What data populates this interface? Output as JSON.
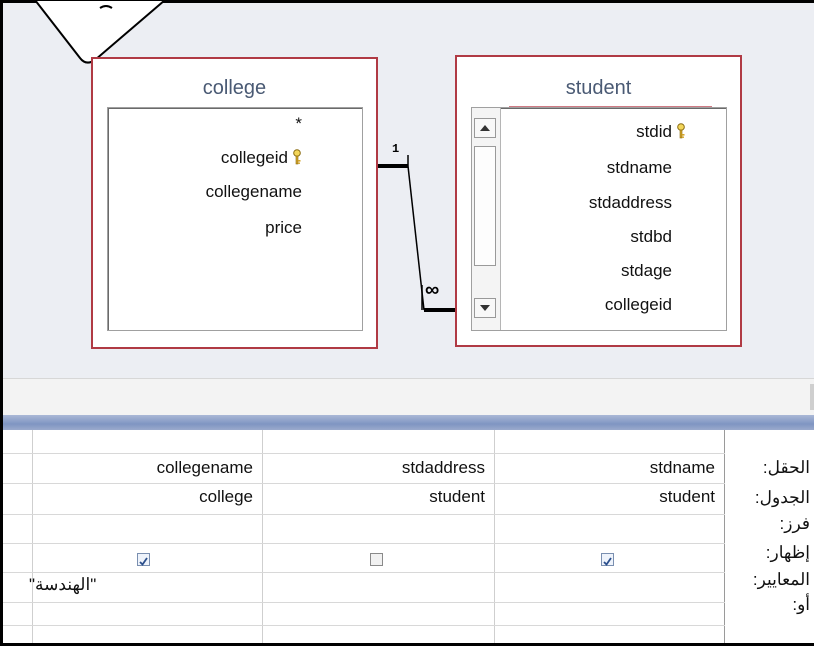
{
  "tables": {
    "college": {
      "title": "college",
      "fields": [
        "*",
        "collegeid",
        "collegename",
        "price"
      ]
    },
    "student": {
      "title": "student",
      "fields": [
        "stdid",
        "stdname",
        "stdaddress",
        "stdbd",
        "stdage",
        "collegeid"
      ]
    }
  },
  "relationship": {
    "one_label": "1",
    "many_label": "∞"
  },
  "grid": {
    "row_labels": [
      "الحقل:",
      "الجدول:",
      "فرز:",
      "إظهار:",
      "المعايير:",
      "أو:"
    ],
    "columns": [
      {
        "field": "stdname",
        "table": "student",
        "sort": "",
        "show": true,
        "criteria": "",
        "or": ""
      },
      {
        "field": "stdaddress",
        "table": "student",
        "sort": "",
        "show": false,
        "criteria": "",
        "or": ""
      },
      {
        "field": "collegename",
        "table": "college",
        "sort": "",
        "show": true,
        "criteria": "\"الهندسة\"",
        "or": ""
      }
    ]
  },
  "icons": {
    "primary_key": "key-icon",
    "scroll_up": "arrow-up-icon",
    "scroll_down": "arrow-down-icon"
  },
  "colors": {
    "table_border": "#b03a44",
    "title_text": "#4a5a74",
    "splitter": "#7f95c2"
  }
}
